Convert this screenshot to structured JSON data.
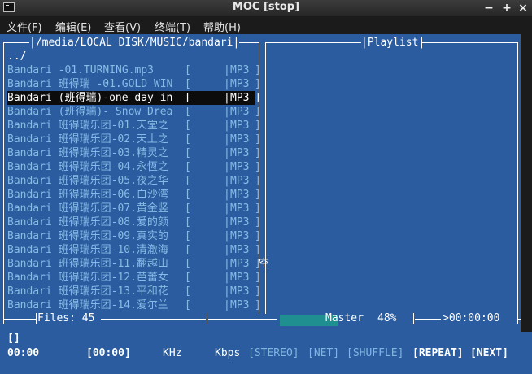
{
  "window": {
    "title": "MOC [stop]"
  },
  "menu": [
    {
      "label": "文件(F)",
      "key": "F"
    },
    {
      "label": "编辑(E)",
      "key": "E"
    },
    {
      "label": "查看(V)",
      "key": "V"
    },
    {
      "label": "终端(T)",
      "key": "T"
    },
    {
      "label": "帮助(H)",
      "key": "H"
    }
  ],
  "browser": {
    "path": "/media/LOCAL DISK/MUSIC/bandari",
    "parent": "../",
    "files": [
      {
        "name": "Bandari -01.TURNING.mp3    ",
        "format": "MP3"
      },
      {
        "name": "Bandari 班得瑞 -01.GOLD WIN",
        "format": "MP3"
      },
      {
        "name": "Bandari (班得瑞)-one day in",
        "format": "MP3",
        "selected": true
      },
      {
        "name": "Bandari (班得瑞)- Snow Drea",
        "format": "MP3"
      },
      {
        "name": "Bandari 班得瑞乐团-01.天堂之",
        "format": "MP3"
      },
      {
        "name": "Bandari 班得瑞乐团-02.天上之",
        "format": "MP3"
      },
      {
        "name": "Bandari 班得瑞乐团-03.精灵之",
        "format": "MP3"
      },
      {
        "name": "Bandari 班得瑞乐团-04.永恆之",
        "format": "MP3"
      },
      {
        "name": "Bandari 班得瑞乐团-05.夜之华",
        "format": "MP3"
      },
      {
        "name": "Bandari 班得瑞乐团-06.白沙湾",
        "format": "MP3"
      },
      {
        "name": "Bandari 班得瑞乐团-07.黄金竖",
        "format": "MP3"
      },
      {
        "name": "Bandari 班得瑞乐团-08.爱的颜",
        "format": "MP3"
      },
      {
        "name": "Bandari 班得瑞乐团-09.真实的",
        "format": "MP3"
      },
      {
        "name": "Bandari 班得瑞乐团-10.清澈海",
        "format": "MP3"
      },
      {
        "name": "Bandari 班得瑞乐团-11.翻越山",
        "format": "MP3",
        "overflow": "空"
      },
      {
        "name": "Bandari 班得瑞乐团-12.芭蕾女",
        "format": "MP3"
      },
      {
        "name": "Bandari 班得瑞乐团-13.平和花",
        "format": "MP3"
      },
      {
        "name": "Bandari 班得瑞乐团-14.爱尔兰",
        "format": "MP3"
      }
    ],
    "files_count_label": "Files: 45"
  },
  "playlist": {
    "title": "Playlist"
  },
  "mixer": {
    "label": "Master",
    "value": "48%",
    "level": 0.48
  },
  "time_left": ">00:00:00",
  "status": {
    "title_line": "[]",
    "current_time": "00:00",
    "total_time": "[00:00]",
    "khz": "KHz",
    "kbps": "Kbps",
    "stereo": "[STEREO]",
    "net": "[NET]",
    "shuffle": "[SHUFFLE]",
    "repeat": "[REPEAT]",
    "next": "[NEXT]"
  },
  "colors": {
    "panel": "#2a5c9f",
    "text": "#86bce6",
    "highlight": "#0c0c0c",
    "mixer": "#1f8f8f"
  }
}
